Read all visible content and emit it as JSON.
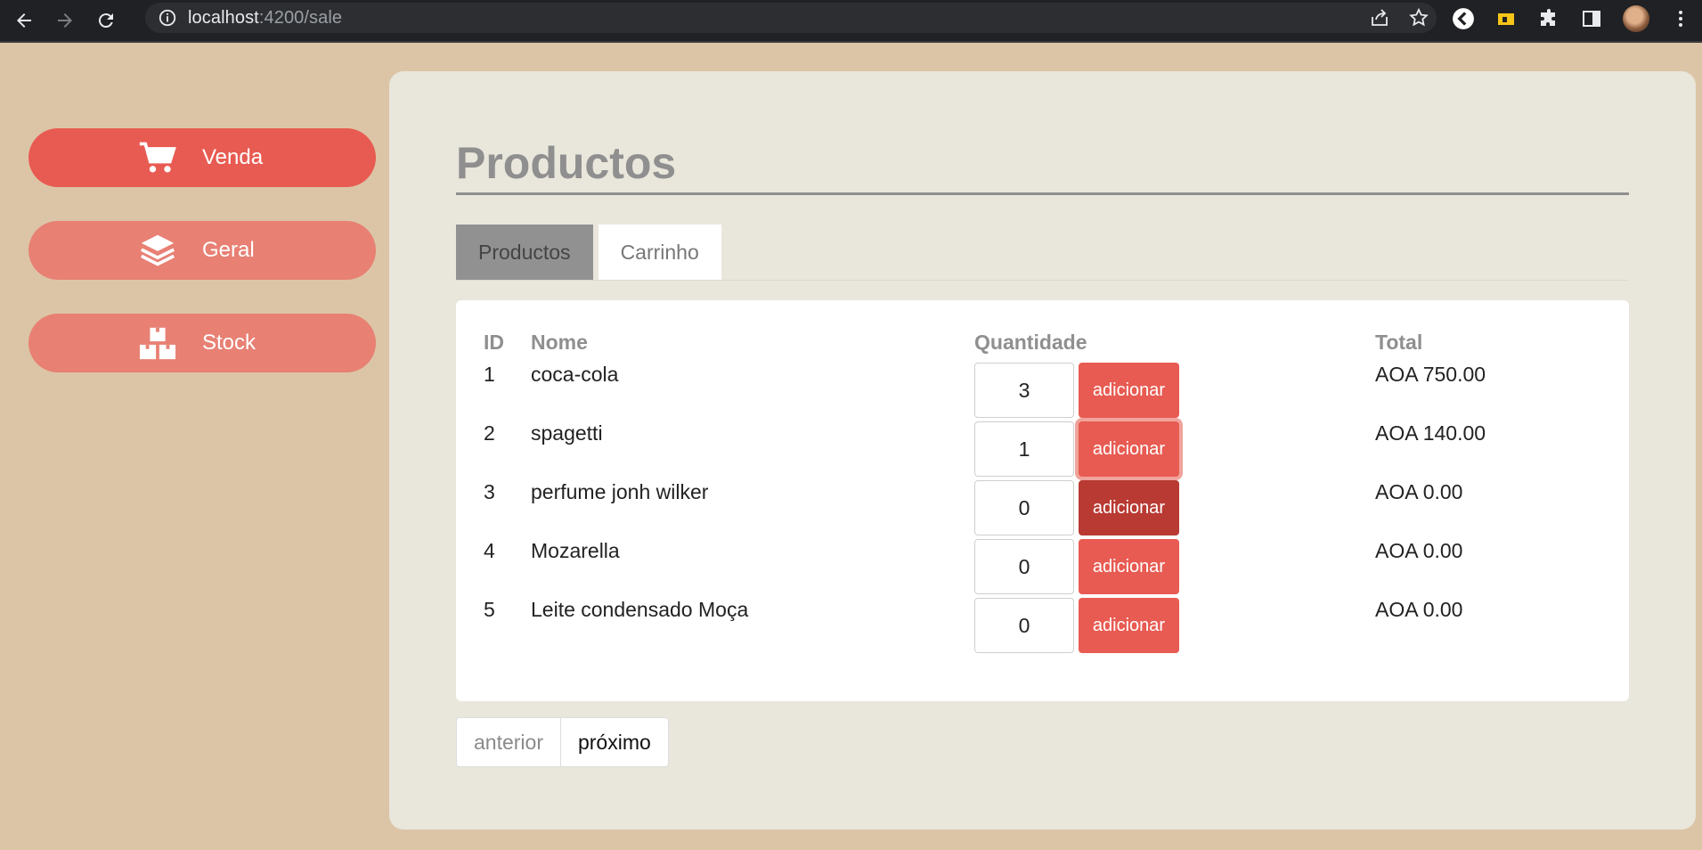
{
  "browser": {
    "url_host": "localhost",
    "url_rest": ":4200/sale"
  },
  "sidebar": {
    "items": [
      {
        "label": "Venda",
        "icon": "cart-icon"
      },
      {
        "label": "Geral",
        "icon": "layers-icon"
      },
      {
        "label": "Stock",
        "icon": "boxes-icon"
      }
    ]
  },
  "main": {
    "title": "Productos",
    "tabs": [
      {
        "label": "Productos",
        "active": true
      },
      {
        "label": "Carrinho",
        "active": false
      }
    ],
    "table": {
      "headers": {
        "id": "ID",
        "name": "Nome",
        "quantity": "Quantidade",
        "total": "Total"
      },
      "add_label": "adicionar",
      "rows": [
        {
          "id": "1",
          "name": "coca-cola",
          "quantity": "3",
          "total": "AOA 750.00"
        },
        {
          "id": "2",
          "name": "spagetti",
          "quantity": "1",
          "total": "AOA 140.00"
        },
        {
          "id": "3",
          "name": "perfume jonh wilker",
          "quantity": "0",
          "total": "AOA 0.00"
        },
        {
          "id": "4",
          "name": "Mozarella",
          "quantity": "0",
          "total": "AOA 0.00"
        },
        {
          "id": "5",
          "name": "Leite condensado Moça",
          "quantity": "0",
          "total": "AOA 0.00"
        }
      ]
    },
    "pager": {
      "prev": "anterior",
      "next": "próximo"
    }
  },
  "colors": {
    "page_bg": "#dcc5a6",
    "panel_bg": "#e9e6dc",
    "accent": "#e85b52",
    "accent_soft": "#e88074",
    "accent_pressed": "#b83a33"
  }
}
